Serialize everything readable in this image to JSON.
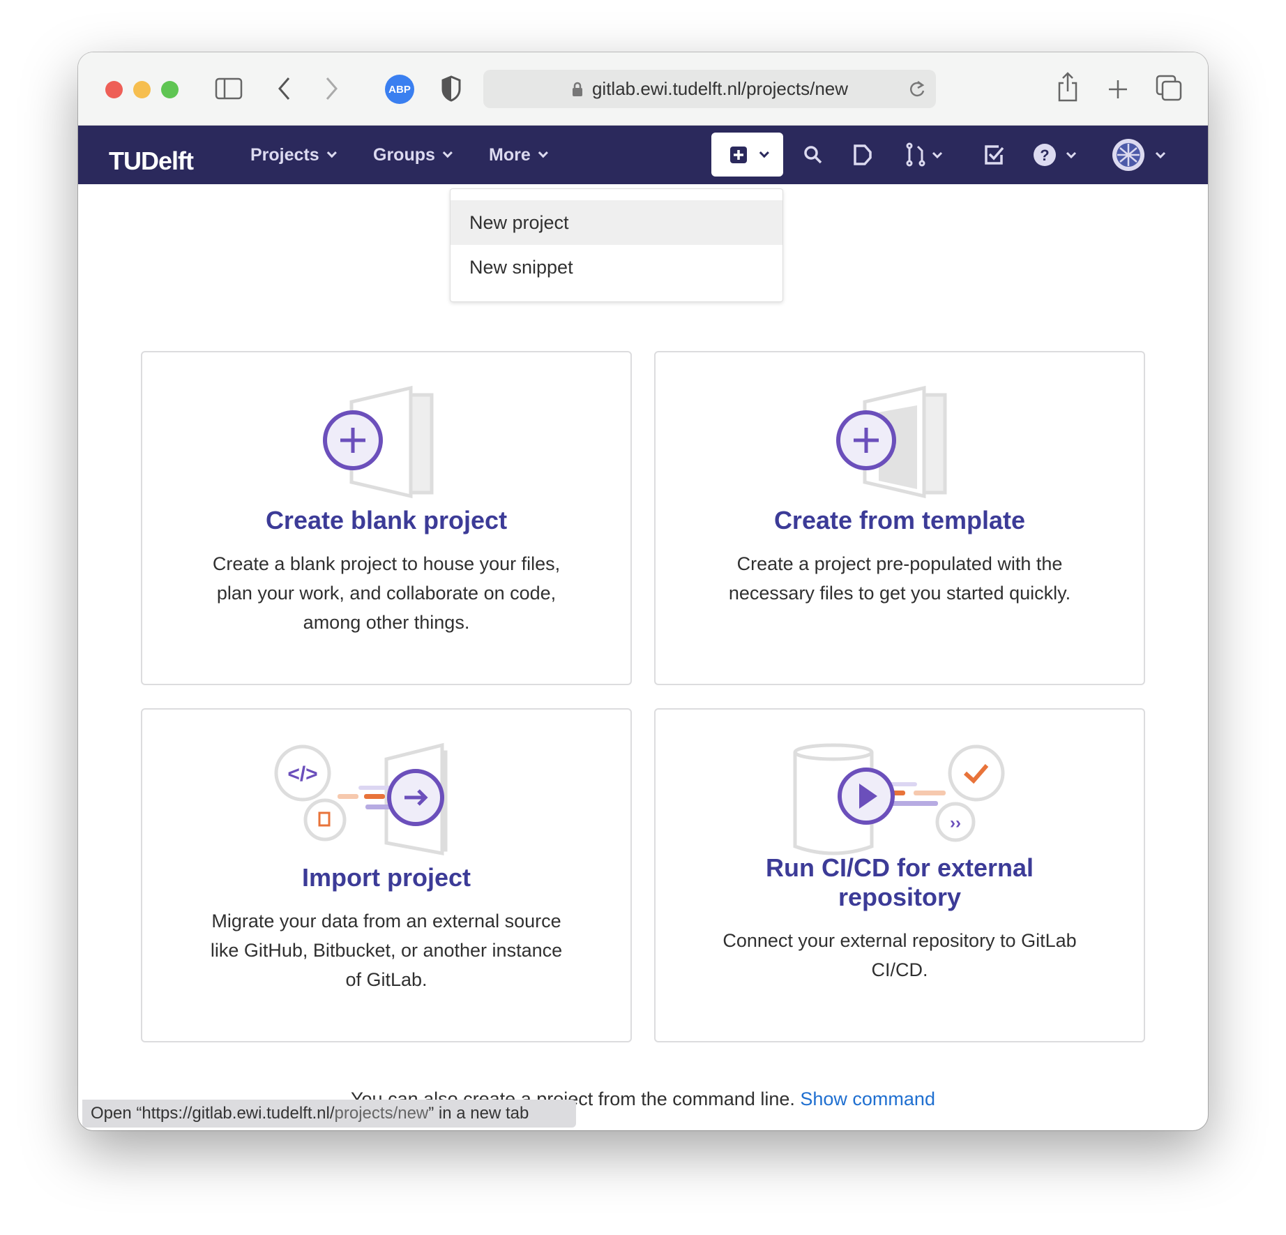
{
  "browser": {
    "url": "gitlab.ewi.tudelft.nl/projects/new",
    "extension_label": "ABP"
  },
  "nav": {
    "logo": "TUDelft",
    "items": [
      {
        "label": "Projects"
      },
      {
        "label": "Groups"
      },
      {
        "label": "More"
      }
    ]
  },
  "dropdown": {
    "items": [
      {
        "label": "New project"
      },
      {
        "label": "New snippet"
      }
    ]
  },
  "cards": [
    {
      "title": "Create blank project",
      "description": "Create a blank project to house your files, plan your work, and collaborate on code, among other things."
    },
    {
      "title": "Create from template",
      "description": "Create a project pre-populated with the necessary files to get you started quickly."
    },
    {
      "title": "Import project",
      "description": "Migrate your data from an external source like GitHub, Bitbucket, or another instance of GitLab."
    },
    {
      "title": "Run CI/CD for external repository",
      "description": "Connect your external repository to GitLab CI/CD."
    }
  ],
  "footer": {
    "text": "You can also create a project from the command line. ",
    "link": "Show command"
  },
  "status": {
    "prefix": "Open “https://gitlab.ewi.tudelft.nl/",
    "path": "projects/new",
    "suffix": "” in a new tab"
  },
  "colors": {
    "nav_bg": "#2b295c",
    "accent": "#6b4fbb",
    "title": "#3c3b97",
    "link": "#1f6fd0"
  }
}
